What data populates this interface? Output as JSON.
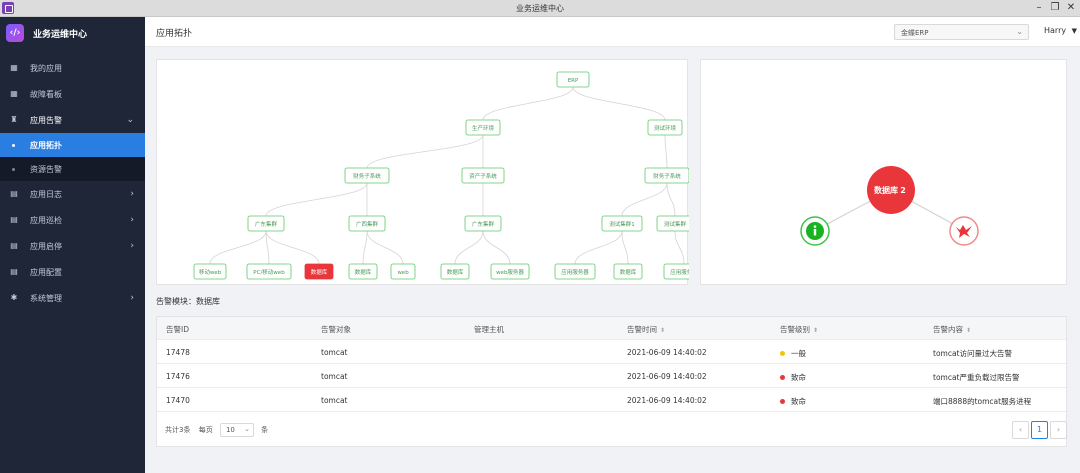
{
  "window": {
    "title": "业务运维中心",
    "controls": [
      "–",
      "❐",
      "✕"
    ]
  },
  "brand": {
    "name": "业务运维中心",
    "logo_icon": "code-bracket-icon"
  },
  "sidebar": {
    "items": [
      {
        "label": "我的应用",
        "icon": "grid-icon"
      },
      {
        "label": "故障看板",
        "icon": "dashboard-icon"
      },
      {
        "label": "应用告警",
        "icon": "bell-icon",
        "expanded": true,
        "children": [
          {
            "label": "应用拓扑",
            "active": true
          },
          {
            "label": "资源告警"
          }
        ]
      },
      {
        "label": "应用日志",
        "icon": "log-icon"
      },
      {
        "label": "应用巡检",
        "icon": "inspect-icon"
      },
      {
        "label": "应用启停",
        "icon": "power-icon"
      },
      {
        "label": "应用配置",
        "icon": "config-icon"
      },
      {
        "label": "系统管理",
        "icon": "gear-icon"
      }
    ]
  },
  "header": {
    "title": "应用拓扑",
    "project": "金蝶ERP",
    "user": "Harry"
  },
  "topology": {
    "nodes": [
      {
        "id": "erp",
        "label": "ERP"
      },
      {
        "id": "prod",
        "label": "生产环境"
      },
      {
        "id": "test",
        "label": "测试环境"
      },
      {
        "id": "fin1",
        "label": "财务子系统"
      },
      {
        "id": "inv",
        "label": "资产子系统"
      },
      {
        "id": "fin2",
        "label": "财务子系统"
      },
      {
        "id": "gd",
        "label": "广东集群"
      },
      {
        "id": "gx",
        "label": "广西集群"
      },
      {
        "id": "gd2",
        "label": "广东集群"
      },
      {
        "id": "t1",
        "label": "测试集群1"
      },
      {
        "id": "t2",
        "label": "测试集群"
      },
      {
        "id": "web1",
        "label": "移动web"
      },
      {
        "id": "pc",
        "label": "PC/移动web"
      },
      {
        "id": "db1",
        "label": "数据库",
        "alarm": true
      },
      {
        "id": "db2",
        "label": "数据库"
      },
      {
        "id": "web2",
        "label": "web"
      },
      {
        "id": "db3",
        "label": "数据库"
      },
      {
        "id": "websvc",
        "label": "web服务器"
      },
      {
        "id": "app1",
        "label": "应用服务器"
      },
      {
        "id": "db4",
        "label": "数据库"
      },
      {
        "id": "app2",
        "label": "应用服务器"
      }
    ]
  },
  "detail": {
    "center_label": "数据库",
    "center_count": "2",
    "ok_icon": "info-icon",
    "err_icon": "error-icon"
  },
  "alarms": {
    "title_prefix": "告警模块：",
    "title_value": "数据库",
    "columns": [
      "告警ID",
      "告警对象",
      "管理主机",
      "告警时间",
      "告警级别",
      "告警内容"
    ],
    "rows": [
      {
        "id": "17478",
        "object": "tomcat",
        "host": "",
        "time": "2021-06-09 14:40:02",
        "level": "一般",
        "level_color": "#f5c400",
        "content": "tomcat访问量过大告警"
      },
      {
        "id": "17476",
        "object": "tomcat",
        "host": "",
        "time": "2021-06-09 14:40:02",
        "level": "致命",
        "level_color": "#e8363a",
        "content": "tomcat严重负载过限告警"
      },
      {
        "id": "17470",
        "object": "tomcat",
        "host": "",
        "time": "2021-06-09 14:40:02",
        "level": "致命",
        "level_color": "#e8363a",
        "content": "端口8888的tomcat服务进程"
      }
    ],
    "pager": {
      "total": "共计3条",
      "per_page_label": "每页",
      "page_size": "10",
      "unit": "条",
      "current_page": "1",
      "prev": "‹",
      "next": "›"
    }
  }
}
